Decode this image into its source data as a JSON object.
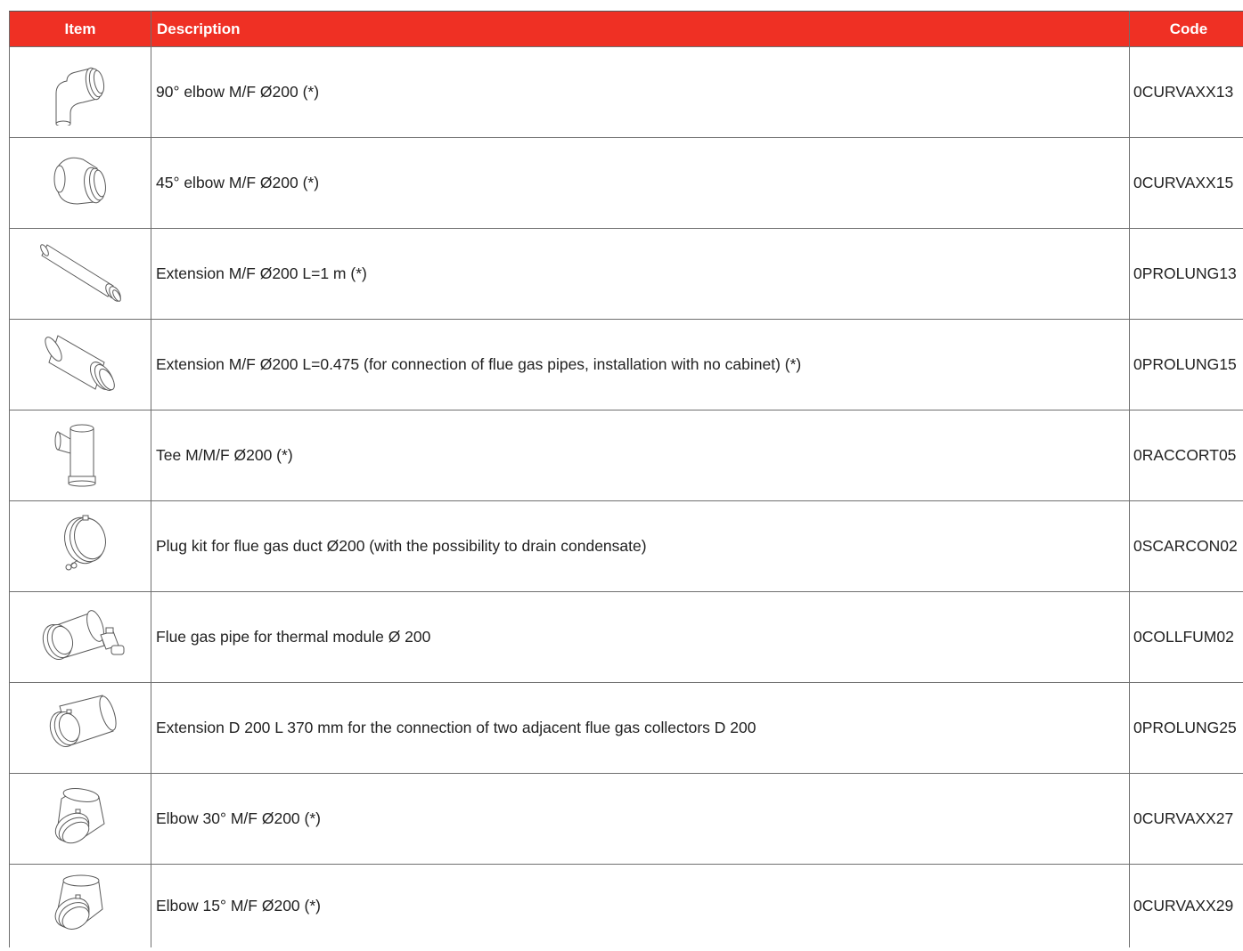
{
  "table": {
    "headers": {
      "item": "Item",
      "description": "Description",
      "code": "Code"
    },
    "rows": [
      {
        "icon": "elbow-90-icon",
        "description": "90° elbow M/F Ø200 (*)",
        "code": "0CURVAXX13"
      },
      {
        "icon": "elbow-45-icon",
        "description": "45° elbow M/F Ø200 (*)",
        "code": "0CURVAXX15"
      },
      {
        "icon": "extension-1m-icon",
        "description": "Extension M/F Ø200 L=1 m (*)",
        "code": "0PROLUNG13"
      },
      {
        "icon": "extension-short-icon",
        "description": "Extension M/F Ø200 L=0.475 (for connection of flue gas pipes, installation with no cabinet) (*)",
        "code": "0PROLUNG15"
      },
      {
        "icon": "tee-icon",
        "description": "Tee M/M/F Ø200 (*)",
        "code": "0RACCORT05"
      },
      {
        "icon": "plug-kit-icon",
        "description": "Plug kit for flue gas duct Ø200 (with the possibility to drain condensate)",
        "code": "0SCARCON02"
      },
      {
        "icon": "flue-gas-pipe-icon",
        "description": "Flue gas pipe for thermal module Ø 200",
        "code": "0COLLFUM02"
      },
      {
        "icon": "extension-370-icon",
        "description": "Extension D 200 L 370 mm for the connection of two adjacent flue gas collectors D 200",
        "code": "0PROLUNG25"
      },
      {
        "icon": "elbow-30-icon",
        "description": "Elbow 30° M/F Ø200 (*)",
        "code": "0CURVAXX27"
      },
      {
        "icon": "elbow-15-icon",
        "description": "Elbow 15° M/F Ø200 (*)",
        "code": "0CURVAXX29"
      }
    ]
  },
  "colors": {
    "header_bg": "#ef3024",
    "header_text": "#ffffff",
    "border": "#6f6f6f"
  }
}
